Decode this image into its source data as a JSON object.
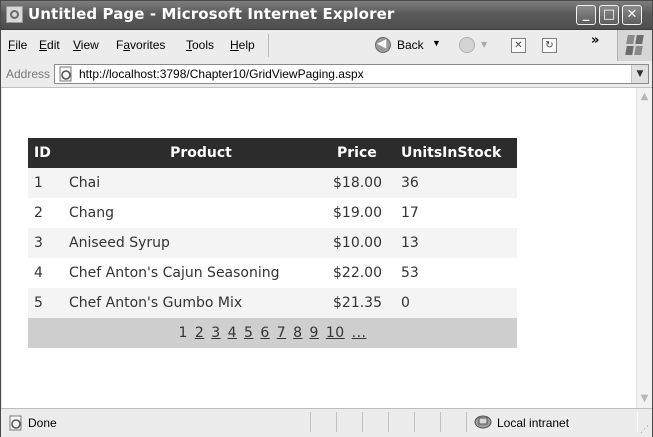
{
  "window": {
    "title": "Untitled Page - Microsoft Internet Explorer"
  },
  "menu": {
    "items": [
      {
        "label": "File",
        "u": "F",
        "rest": "ile"
      },
      {
        "label": "Edit",
        "u": "E",
        "rest": "dit"
      },
      {
        "label": "View",
        "u": "V",
        "rest": "iew"
      },
      {
        "label": "Favorites",
        "pre": "F",
        "u": "a",
        "rest": "vorites"
      },
      {
        "label": "Tools",
        "u": "T",
        "rest": "ools"
      },
      {
        "label": "Help",
        "u": "H",
        "rest": "elp"
      }
    ],
    "back_label": "Back",
    "chevron": "»"
  },
  "address": {
    "label": "Address",
    "url": "http://localhost:3798/Chapter10/GridViewPaging.aspx"
  },
  "grid": {
    "headers": [
      "ID",
      "Product",
      "Price",
      "UnitsInStock"
    ],
    "rows": [
      [
        "1",
        "Chai",
        "$18.00",
        "36"
      ],
      [
        "2",
        "Chang",
        "$19.00",
        "17"
      ],
      [
        "3",
        "Aniseed Syrup",
        "$10.00",
        "13"
      ],
      [
        "4",
        "Chef Anton's Cajun Seasoning",
        "$22.00",
        "53"
      ],
      [
        "5",
        "Chef Anton's Gumbo Mix",
        "$21.35",
        "0"
      ]
    ],
    "pager": {
      "current": "1",
      "pages": [
        "2",
        "3",
        "4",
        "5",
        "6",
        "7",
        "8",
        "9",
        "10",
        "..."
      ]
    }
  },
  "status": {
    "text": "Done",
    "zone": "Local intranet"
  },
  "colors": {
    "header_bg": "#2c2c2c",
    "pager_bg": "#cfcfcf",
    "alt_row": "#f4f4f4"
  }
}
